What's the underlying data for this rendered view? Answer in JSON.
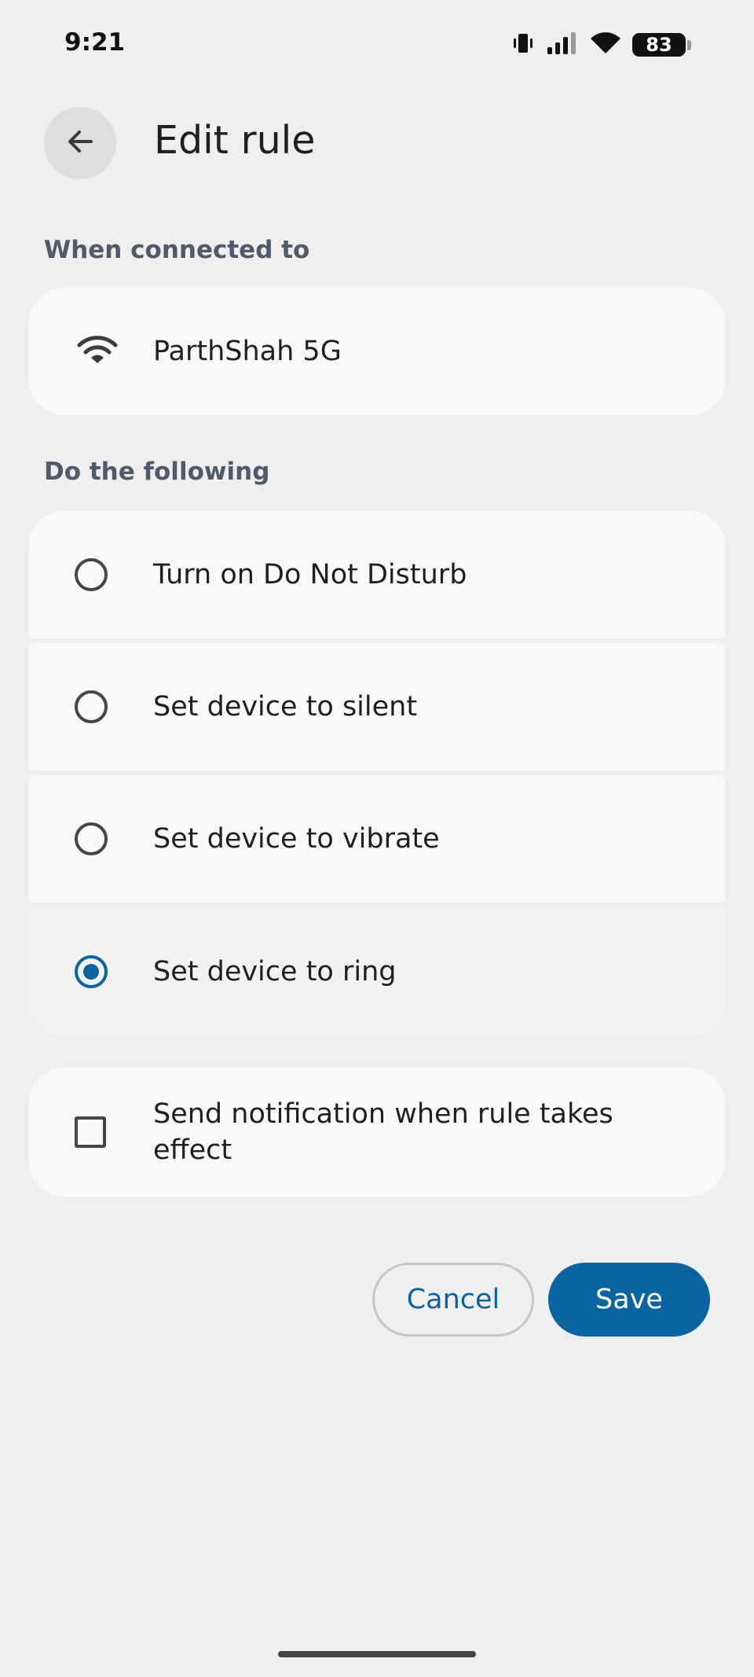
{
  "status_bar": {
    "time": "9:21",
    "battery_level": "83",
    "icons": [
      "vibrate-icon",
      "cell-signal-icon",
      "wifi-icon",
      "battery-icon"
    ]
  },
  "header": {
    "title": "Edit rule",
    "back_icon": "arrow-left-icon"
  },
  "trigger_section": {
    "label": "When connected to",
    "network": {
      "icon": "wifi-icon",
      "name": "ParthShah 5G"
    }
  },
  "action_section": {
    "label": "Do the following",
    "options": [
      {
        "label": "Turn on Do Not Disturb",
        "selected": false
      },
      {
        "label": "Set device to silent",
        "selected": false
      },
      {
        "label": "Set device to vibrate",
        "selected": false
      },
      {
        "label": "Set device to ring",
        "selected": true
      }
    ]
  },
  "notification_option": {
    "label": "Send notification when rule takes effect",
    "checked": false
  },
  "buttons": {
    "cancel": "Cancel",
    "save": "Save"
  },
  "colors": {
    "accent": "#0b64a0",
    "background": "#efefef",
    "card": "#f9f9f9",
    "card_selected": "#f2f2f2",
    "section_label": "#4f5b6a"
  }
}
